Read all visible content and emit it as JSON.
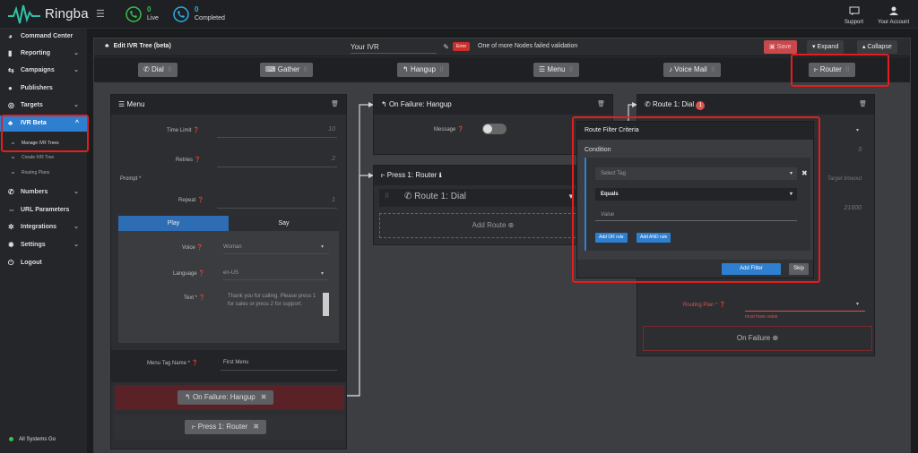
{
  "app": {
    "brand": "Ringba",
    "live_count": "0",
    "live_label": "Live",
    "completed_count": "0",
    "completed_label": "Completed",
    "support_label": "Support",
    "account_label": "Your Account"
  },
  "sidebar": {
    "items": [
      {
        "label": "Command Center"
      },
      {
        "label": "Reporting"
      },
      {
        "label": "Campaigns"
      },
      {
        "label": "Publishers"
      },
      {
        "label": "Targets"
      },
      {
        "label": "IVR Beta"
      },
      {
        "label": "Numbers"
      },
      {
        "label": "URL Parameters"
      },
      {
        "label": "Integrations"
      },
      {
        "label": "Settings"
      },
      {
        "label": "Logout"
      }
    ],
    "sub_items": [
      {
        "label": "Manage IVR Trees"
      },
      {
        "label": "Create IVR Tree"
      },
      {
        "label": "Routing Plans"
      }
    ],
    "status": "All Systems Go"
  },
  "editor": {
    "title": "Edit IVR Tree (beta)",
    "tree_name": "Your IVR",
    "error_badge": "Error",
    "error_text": "One of more Nodes failed validation",
    "save_label": "Save",
    "expand_label": "Expand",
    "collapse_label": "Collapse"
  },
  "palette": [
    {
      "label": "Dial"
    },
    {
      "label": "Gather"
    },
    {
      "label": "Hangup"
    },
    {
      "label": "Menu"
    },
    {
      "label": "Voice Mail"
    },
    {
      "label": "Router"
    }
  ],
  "menu_node": {
    "title": "Menu",
    "time_limit_label": "Time Limit",
    "time_limit_value": "10",
    "retries_label": "Retries",
    "retries_value": "2",
    "prompt_label": "Prompt *",
    "repeat_label": "Repeat",
    "repeat_value": "1",
    "tab_play": "Play",
    "tab_say": "Say",
    "voice_label": "Voice",
    "voice_value": "Woman",
    "language_label": "Language",
    "language_value": "en-US",
    "text_label": "Text *",
    "text_value": "Thank you for calling. Please press 1 for sales or press 2 for support.",
    "tag_label": "Menu Tag Name *",
    "tag_value": "First Menu",
    "on_failure": "On Failure: Hangup",
    "press1": "Press 1: Router"
  },
  "failure_node": {
    "title": "On Failure: Hangup",
    "message_label": "Message"
  },
  "router_node": {
    "title": "Press 1: Router",
    "route_label": "Route 1: Dial",
    "add_route": "Add Route"
  },
  "dial_node": {
    "title": "Route 1: Dial",
    "badge": "1",
    "value_3": "3",
    "timeout_hint": "Target timeout",
    "value_21600": "21600",
    "routing_label": "Routing Plan *",
    "routing_error": "must have value",
    "on_failure": "On Failure"
  },
  "modal": {
    "title": "Route Filter Criteria",
    "condition_label": "Condition",
    "select_tag_placeholder": "Select Tag",
    "operator": "Equals",
    "value_placeholder": "Value",
    "add_or": "Add OR rule",
    "add_and": "Add AND rule",
    "add_filter": "Add Filter",
    "skip": "Skip"
  }
}
